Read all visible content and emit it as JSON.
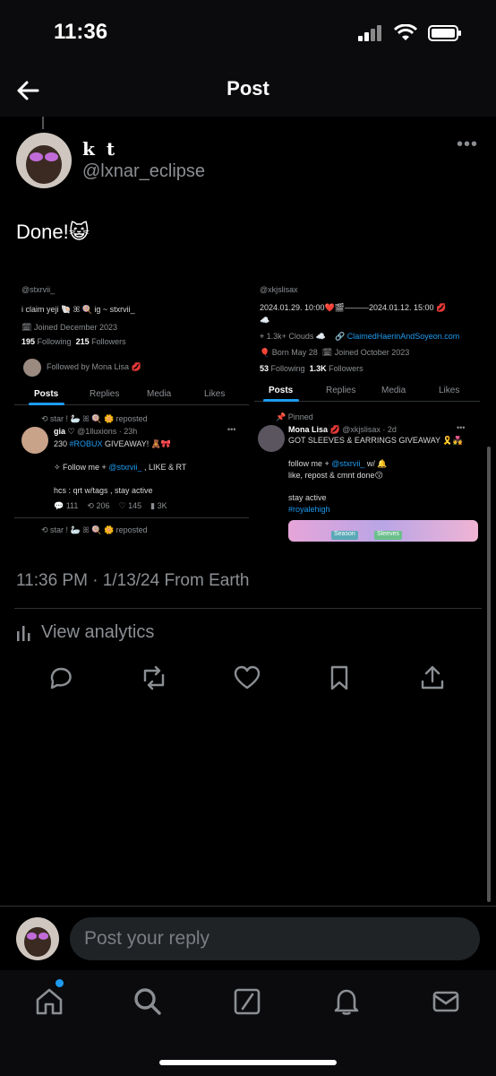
{
  "status_bar": {
    "time": "11:36"
  },
  "header": {
    "title": "Post"
  },
  "post": {
    "display_name": "k t",
    "handle": "@lxnar_eclipse",
    "text": "Done!😺",
    "timestamp": "11:36 PM · 1/13/24 From Earth",
    "analytics_label": "View analytics"
  },
  "media": {
    "left": {
      "bio": "i claim yeji 🐚 ꕤ 🍭 ig ~ stxrvii_",
      "handle": "@stxrvii_",
      "joined": "Joined December 2023",
      "following": "195",
      "following_label": "Following",
      "followers": "215",
      "followers_label": "Followers",
      "followed_by": "Followed by Mona Lisa 💋",
      "tabs": [
        "Posts",
        "Replies",
        "Media",
        "Likes"
      ],
      "reposted_by": "star ! 🦢 ꕤ 🍭 🌼 reposted",
      "tweet_name": "gia ♡",
      "tweet_handle": "@1lluxions · 23h",
      "tweet_line1_pre": "230 ",
      "tweet_line1_link": "#ROBUX",
      "tweet_line1_post": " GIVEAWAY! 🧸🎀",
      "tweet_line2_pre": "✧ Follow me + ",
      "tweet_line2_link": "@stxrvii_",
      "tweet_line2_post": " , LIKE & RT",
      "tweet_line3": "hcs : qrt w/tags , stay active",
      "replies": "111",
      "reposts": "206",
      "likes": "145",
      "views": "3K",
      "reposted_by_2": "star ! 🦢 ꕤ 🍭 🌼 reposted"
    },
    "right": {
      "name": "Mona Lisa 💋",
      "handle": "@xkjslisax",
      "bio": "2024.01.29. 10:00❤️🎬———2024.01.12. 15:00 💋",
      "cloud": "☁️",
      "location": "1.3k+ Clouds ☁️",
      "website": "ClaimedHaerinAndSoyeon.com",
      "born": "Born May 28",
      "joined": "Joined October 2023",
      "following": "53",
      "following_label": "Following",
      "followers": "1.3K",
      "followers_label": "Followers",
      "tabs": [
        "Posts",
        "Replies",
        "Media",
        "Likes"
      ],
      "pinned": "Pinned",
      "tweet_name": "Mona Lisa 💋",
      "tweet_handle": "@xkjslisax · 2d",
      "tweet_line1": "GOT SLEEVES & EARRINGS GIVEAWAY 🎗️💑",
      "tweet_line2_pre": "follow me + ",
      "tweet_line2_link": "@stxrvii_",
      "tweet_line2_post": " w/ 🔔",
      "tweet_line3": "like, repost & cmnt done😗",
      "tweet_line4": "stay active",
      "tweet_hashtag": "#royalehigh",
      "promo_chips": [
        "Season",
        "Sleeves"
      ]
    }
  },
  "reply": {
    "placeholder": "Post your reply"
  },
  "colors": {
    "accent": "#1d9bf0",
    "muted": "#8b8f93",
    "background": "#000000"
  }
}
